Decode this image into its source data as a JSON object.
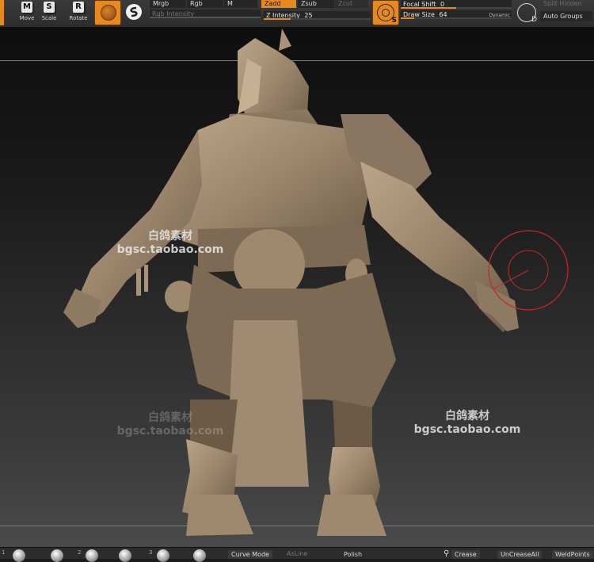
{
  "toolbar": {
    "transform": [
      {
        "key": "M",
        "label": "Move"
      },
      {
        "key": "S",
        "label": "Scale"
      },
      {
        "key": "R",
        "label": "Rotate"
      }
    ],
    "mrgb": "Mrgb",
    "rgb": "Rgb",
    "m": "M",
    "rgb_intensity": "Rgb Intensity",
    "zadd": "Zadd",
    "zsub": "Zsub",
    "zcut": "Zcut",
    "z_intensity": {
      "label": "Z Intensity",
      "value": "25",
      "fraction": 0.25
    },
    "focal_shift": {
      "label": "Focal Shift",
      "value": "0",
      "fraction": 0.5
    },
    "draw_size": {
      "label": "Draw Size",
      "value": "64",
      "fraction": 0.12
    },
    "dynamic_label": "Dynamic",
    "s_key": "S",
    "d_key": "D",
    "split_hidden": "Split Hidden",
    "auto_groups": "Auto Groups"
  },
  "canvas": {
    "watermarks": [
      {
        "line1": "白鸽素材",
        "line2": "bgsc.taobao.com"
      },
      {
        "line1": "白鸽素材",
        "line2": "bgsc.taobao.com"
      },
      {
        "line1": "白鸽素材",
        "line2": "bgsc.taobao.com"
      }
    ]
  },
  "bottom": {
    "num1": "1",
    "num2": "2",
    "num3": "3",
    "curve_mode": "Curve Mode",
    "as_line": "AsLine",
    "polish": "Polish",
    "crease": "Crease",
    "uncrease_all": "UnCreaseAll",
    "weld_points": "WeldPoints"
  },
  "colors": {
    "accent": "#e8891e",
    "sculpt": "#a08a72",
    "brush_circle": "#c62828"
  }
}
